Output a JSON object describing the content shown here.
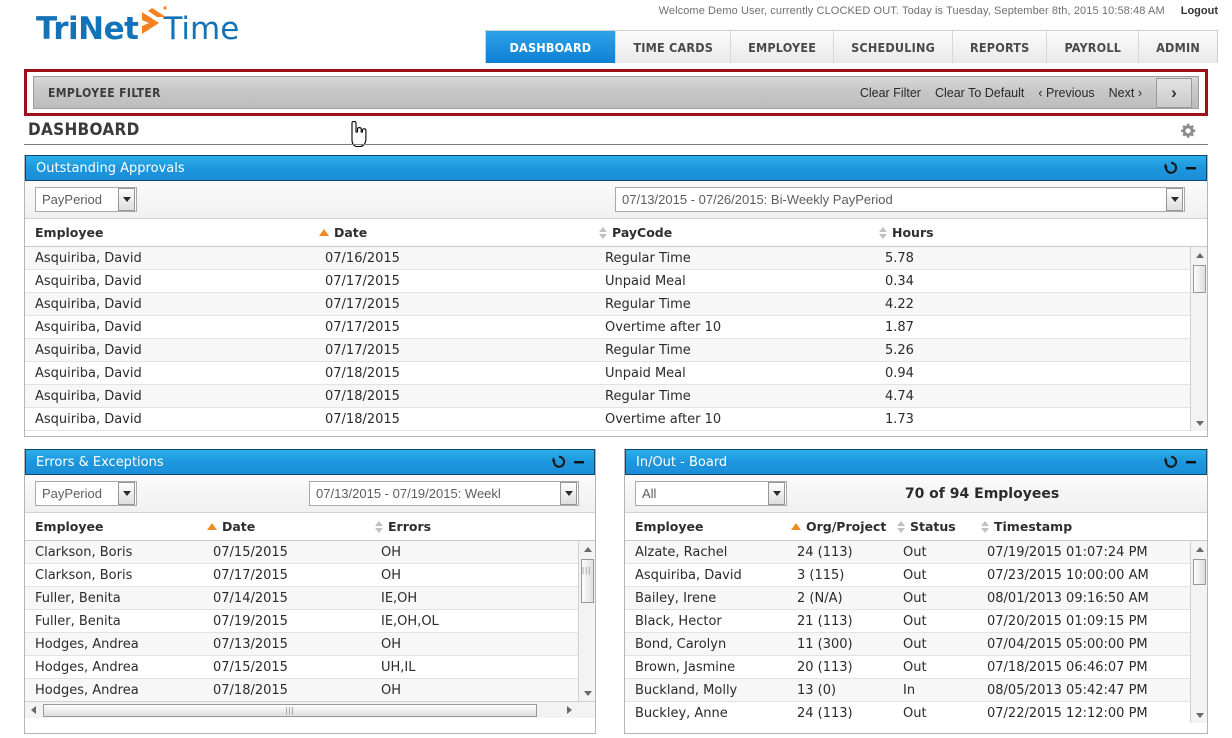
{
  "brand": {
    "logo_tri": "TriNet",
    "logo_time": "Time",
    "accent_blue": "#1273b8",
    "accent_orange": "#f58220",
    "highlight_red": "#a11018"
  },
  "header": {
    "welcome": "Welcome Demo User, currently CLOCKED OUT. Today is Tuesday, September 8th, 2015 10:58:48 AM",
    "logout": "Logout",
    "tabs": [
      {
        "label": "DASHBOARD",
        "active": true
      },
      {
        "label": "TIME CARDS",
        "active": false
      },
      {
        "label": "EMPLOYEE",
        "active": false
      },
      {
        "label": "SCHEDULING",
        "active": false
      },
      {
        "label": "REPORTS",
        "active": false
      },
      {
        "label": "PAYROLL",
        "active": false
      },
      {
        "label": "ADMIN",
        "active": false
      }
    ]
  },
  "employee_filter": {
    "label": "EMPLOYEE FILTER",
    "clear_filter": "Clear Filter",
    "clear_to_default": "Clear To Default",
    "previous": "‹ Previous",
    "next": "Next ›",
    "expand": "›"
  },
  "page": {
    "title": "DASHBOARD",
    "settings_icon": "gear-icon"
  },
  "panels": {
    "outstanding_approvals": {
      "title": "Outstanding Approvals",
      "refresh_icon": "refresh-icon",
      "minimize_icon": "minimize-icon",
      "period_type": "PayPeriod",
      "period_range": "07/13/2015 - 07/26/2015: Bi-Weekly PayPeriod",
      "columns": [
        "Employee",
        "Date",
        "PayCode",
        "Hours"
      ],
      "sorted_column": "Date",
      "rows": [
        {
          "employee": "Asquiriba, David",
          "date": "07/16/2015",
          "paycode": "Regular Time",
          "hours": "5.78"
        },
        {
          "employee": "Asquiriba, David",
          "date": "07/17/2015",
          "paycode": "Unpaid Meal",
          "hours": "0.34"
        },
        {
          "employee": "Asquiriba, David",
          "date": "07/17/2015",
          "paycode": "Regular Time",
          "hours": "4.22"
        },
        {
          "employee": "Asquiriba, David",
          "date": "07/17/2015",
          "paycode": "Overtime after 10",
          "hours": "1.87"
        },
        {
          "employee": "Asquiriba, David",
          "date": "07/17/2015",
          "paycode": "Regular Time",
          "hours": "5.26"
        },
        {
          "employee": "Asquiriba, David",
          "date": "07/18/2015",
          "paycode": "Unpaid Meal",
          "hours": "0.94"
        },
        {
          "employee": "Asquiriba, David",
          "date": "07/18/2015",
          "paycode": "Regular Time",
          "hours": "4.74"
        },
        {
          "employee": "Asquiriba, David",
          "date": "07/18/2015",
          "paycode": "Overtime after 10",
          "hours": "1.73"
        }
      ]
    },
    "errors_exceptions": {
      "title": "Errors & Exceptions",
      "refresh_icon": "refresh-icon",
      "minimize_icon": "minimize-icon",
      "period_type": "PayPeriod",
      "period_range": "07/13/2015 - 07/19/2015: Weekl",
      "columns": [
        "Employee",
        "Date",
        "Errors"
      ],
      "sorted_column": "Date",
      "rows": [
        {
          "employee": "Clarkson, Boris",
          "date": "07/15/2015",
          "errors": "OH"
        },
        {
          "employee": "Clarkson, Boris",
          "date": "07/17/2015",
          "errors": "OH"
        },
        {
          "employee": "Fuller, Benita",
          "date": "07/14/2015",
          "errors": "IE,OH"
        },
        {
          "employee": "Fuller, Benita",
          "date": "07/19/2015",
          "errors": "IE,OH,OL"
        },
        {
          "employee": "Hodges, Andrea",
          "date": "07/13/2015",
          "errors": "OH"
        },
        {
          "employee": "Hodges, Andrea",
          "date": "07/15/2015",
          "errors": "UH,IL"
        },
        {
          "employee": "Hodges, Andrea",
          "date": "07/18/2015",
          "errors": "OH"
        }
      ]
    },
    "in_out_board": {
      "title": "In/Out - Board",
      "refresh_icon": "refresh-icon",
      "minimize_icon": "minimize-icon",
      "filter_value": "All",
      "count_label": "70 of 94 Employees",
      "columns": [
        "Employee",
        "Org/Project",
        "Status",
        "Timestamp"
      ],
      "sorted_column": "Employee",
      "rows": [
        {
          "employee": "Alzate, Rachel",
          "org": "24 (113)",
          "status": "Out",
          "timestamp": "07/19/2015 01:07:24 PM"
        },
        {
          "employee": "Asquiriba, David",
          "org": "3 (115)",
          "status": "Out",
          "timestamp": "07/23/2015 10:00:00 AM"
        },
        {
          "employee": "Bailey, Irene",
          "org": "2 (N/A)",
          "status": "Out",
          "timestamp": "08/01/2013 09:16:50 AM"
        },
        {
          "employee": "Black, Hector",
          "org": "21 (113)",
          "status": "Out",
          "timestamp": "07/20/2015 01:09:15 PM"
        },
        {
          "employee": "Bond, Carolyn",
          "org": "11 (300)",
          "status": "Out",
          "timestamp": "07/04/2015 05:00:00 PM"
        },
        {
          "employee": "Brown, Jasmine",
          "org": "20 (113)",
          "status": "Out",
          "timestamp": "07/18/2015 06:46:07 PM"
        },
        {
          "employee": "Buckland, Molly",
          "org": "13 (0)",
          "status": "In",
          "timestamp": "08/05/2013 05:42:47 PM"
        },
        {
          "employee": "Buckley, Anne",
          "org": "24 (113)",
          "status": "Out",
          "timestamp": "07/22/2015 12:12:00 PM"
        }
      ]
    }
  }
}
